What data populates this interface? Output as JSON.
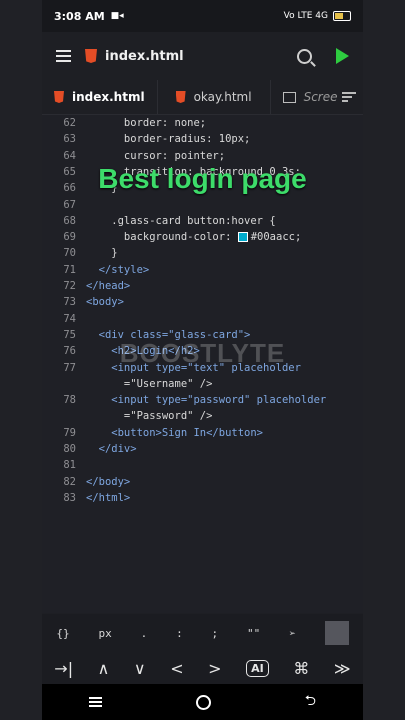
{
  "status": {
    "time": "3:08 AM",
    "indicators": "Vo LTE  4G"
  },
  "appbar": {
    "file_title": "index.html"
  },
  "tabs": [
    {
      "label": "index.html"
    },
    {
      "label": "okay.html"
    },
    {
      "label": "Scree"
    }
  ],
  "overlay": {
    "title": "Best login page",
    "watermark": "BOOSTLYTE"
  },
  "code_lines": [
    {
      "n": "62",
      "text": "      border: none;"
    },
    {
      "n": "63",
      "text": "      border-radius: 10px;"
    },
    {
      "n": "64",
      "text": "      cursor: pointer;"
    },
    {
      "n": "65",
      "text": "      transition: background 0.3s;"
    },
    {
      "n": "66",
      "text": "    }"
    },
    {
      "n": "67",
      "text": ""
    },
    {
      "n": "68",
      "text": "    .glass-card button:hover {"
    },
    {
      "n": "69",
      "text": "      background-color: #00aacc;"
    },
    {
      "n": "70",
      "text": "    }"
    },
    {
      "n": "71",
      "text": "  </style>"
    },
    {
      "n": "72",
      "text": "</head>"
    },
    {
      "n": "73",
      "text": "<body>"
    },
    {
      "n": "74",
      "text": ""
    },
    {
      "n": "75",
      "text": "  <div class=\"glass-card\">"
    },
    {
      "n": "76",
      "text": "    <h2>Login</h2>"
    },
    {
      "n": "77",
      "text": "    <input type=\"text\" placeholder"
    },
    {
      "n": "",
      "text": "      =\"Username\" />"
    },
    {
      "n": "78",
      "text": "    <input type=\"password\" placeholder"
    },
    {
      "n": "",
      "text": "      =\"Password\" />"
    },
    {
      "n": "79",
      "text": "    <button>Sign In</button>"
    },
    {
      "n": "80",
      "text": "  </div>"
    },
    {
      "n": "81",
      "text": ""
    },
    {
      "n": "82",
      "text": "</body>"
    },
    {
      "n": "83",
      "text": "</html>"
    }
  ],
  "keys_row1": [
    "{}",
    "px",
    ".",
    ":",
    ";",
    "\"\""
  ],
  "keys_row2": [
    "→|",
    "∧",
    "∨",
    "<",
    ">",
    "AI",
    "⌘",
    "≫"
  ],
  "colors": {
    "accent_green": "#3ddc6a",
    "swatch": "#00aacc"
  }
}
